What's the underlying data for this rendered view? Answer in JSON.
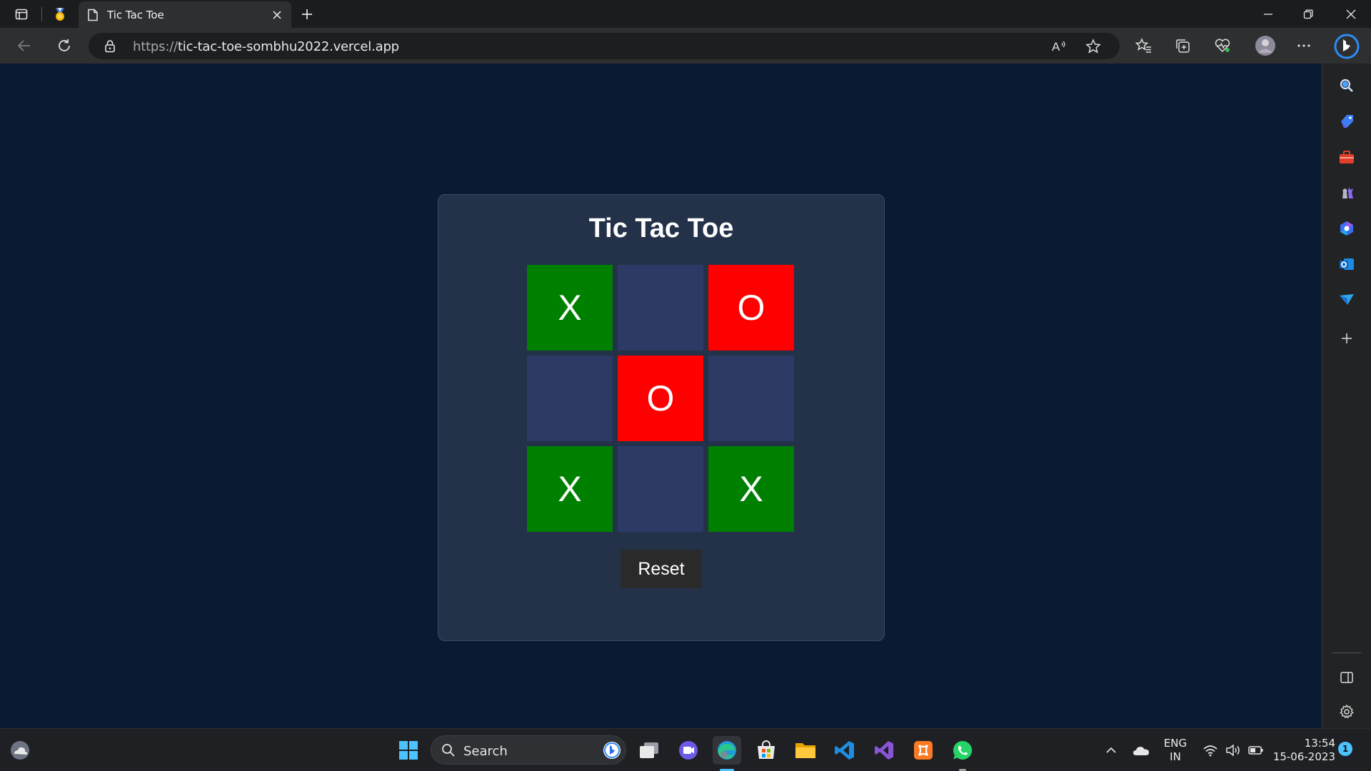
{
  "browser": {
    "tab": {
      "title": "Tic Tac Toe"
    },
    "address": {
      "protocol": "https://",
      "host": "tic-tac-toe-sombhu2022.vercel.app"
    }
  },
  "page": {
    "title": "Tic Tac Toe",
    "board": {
      "cells": [
        "X",
        "",
        "O",
        "",
        "O",
        "",
        "X",
        "",
        "X"
      ]
    },
    "reset_label": "Reset",
    "colors": {
      "x_cell": "#008000",
      "o_cell": "#ff0000",
      "empty_cell": "#2e3a66",
      "card": "#233149",
      "background": "#0b1a33"
    }
  },
  "taskbar": {
    "search_placeholder": "Search",
    "language": {
      "line1": "ENG",
      "line2": "IN"
    },
    "clock": {
      "time": "13:54",
      "date": "15-06-2023"
    },
    "notification_count": "1"
  }
}
